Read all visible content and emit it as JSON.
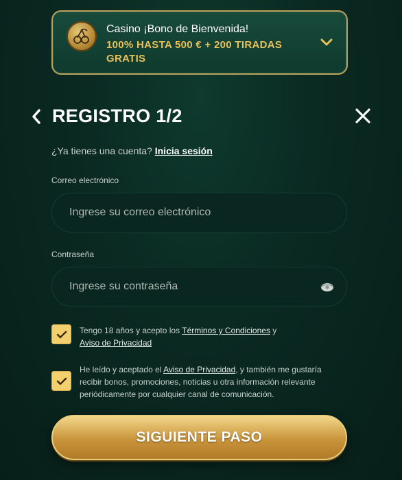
{
  "bonus": {
    "title": "Casino ¡Bono de Bienvenida!",
    "offer": "100% HASTA 500 € + 200 TIRADAS GRATIS",
    "icon": "cherry-coin-icon",
    "expand_icon": "chevron-down-icon"
  },
  "header": {
    "title": "REGISTRO 1/2",
    "back_icon": "chevron-left-icon",
    "close_icon": "close-icon"
  },
  "account": {
    "prompt": "¿Ya tienes una cuenta?",
    "login_link": "Inicia sesión"
  },
  "form": {
    "email_label": "Correo electrónico",
    "email_placeholder": "Ingrese su correo electrónico",
    "email_value": "",
    "password_label": "Contraseña",
    "password_placeholder": "Ingrese su contraseña",
    "password_value": ""
  },
  "consents": {
    "age_prefix": "Tengo 18 años y acepto los ",
    "terms_link": "Términos y Condiciones",
    "age_join": " y",
    "privacy_link": "Aviso de Privacidad",
    "age_checked": true,
    "marketing_prefix": "He leído y aceptado el ",
    "marketing_privacy_link": "Aviso de Privacidad",
    "marketing_suffix": ", y también me gustaría recibir bonos, promociones, noticias u otra información relevante periódicamente por cualquier canal de comunicación.",
    "marketing_checked": true
  },
  "submit": {
    "label": "SIGUIENTE PASO"
  },
  "colors": {
    "background": "#0a2a22",
    "accent_gold": "#e8c15a",
    "checkbox": "#f3cf6e"
  }
}
